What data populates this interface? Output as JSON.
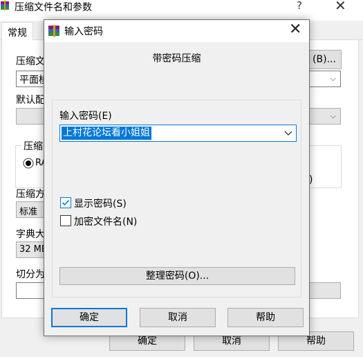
{
  "background_window": {
    "title": "压缩文件名和参数",
    "help_label": "?",
    "close_label": "✕",
    "tab_general": "常规",
    "archive_name_label": "压缩文",
    "browse_button": "(B)...",
    "update_mode_value": "平面棱",
    "default_config_label": "默认配",
    "compression_group_label": "压缩",
    "format_radio_label": "RA",
    "method_label": "压缩方",
    "method_value": "标准",
    "dict_label": "字典大",
    "dict_value": "32 MB",
    "split_label": "切分为",
    "stray_char": ")",
    "ok_button": "确定",
    "cancel_button": "取消",
    "help_button": "帮助"
  },
  "dialog": {
    "title": "输入密码",
    "close_label": "✕",
    "heading": "带密码压缩",
    "password_label": "输入密码(E)",
    "password_value": "上村花论坛看小姐姐",
    "show_password": {
      "label": "显示密码(S)",
      "checked": true
    },
    "encrypt_names": {
      "label": "加密文件名(N)",
      "checked": false
    },
    "organize_button": "整理密码(O)...",
    "ok_button": "确定",
    "cancel_button": "取消",
    "help_button": "帮助"
  },
  "colors": {
    "accent": "#0078d7",
    "button_face": "#e1e1e1",
    "window_bg": "#f0f0f0"
  },
  "icons": [
    "winrar-app-icon",
    "chevron-down-icon",
    "checkmark-icon",
    "close-icon",
    "radio-selected-icon"
  ]
}
